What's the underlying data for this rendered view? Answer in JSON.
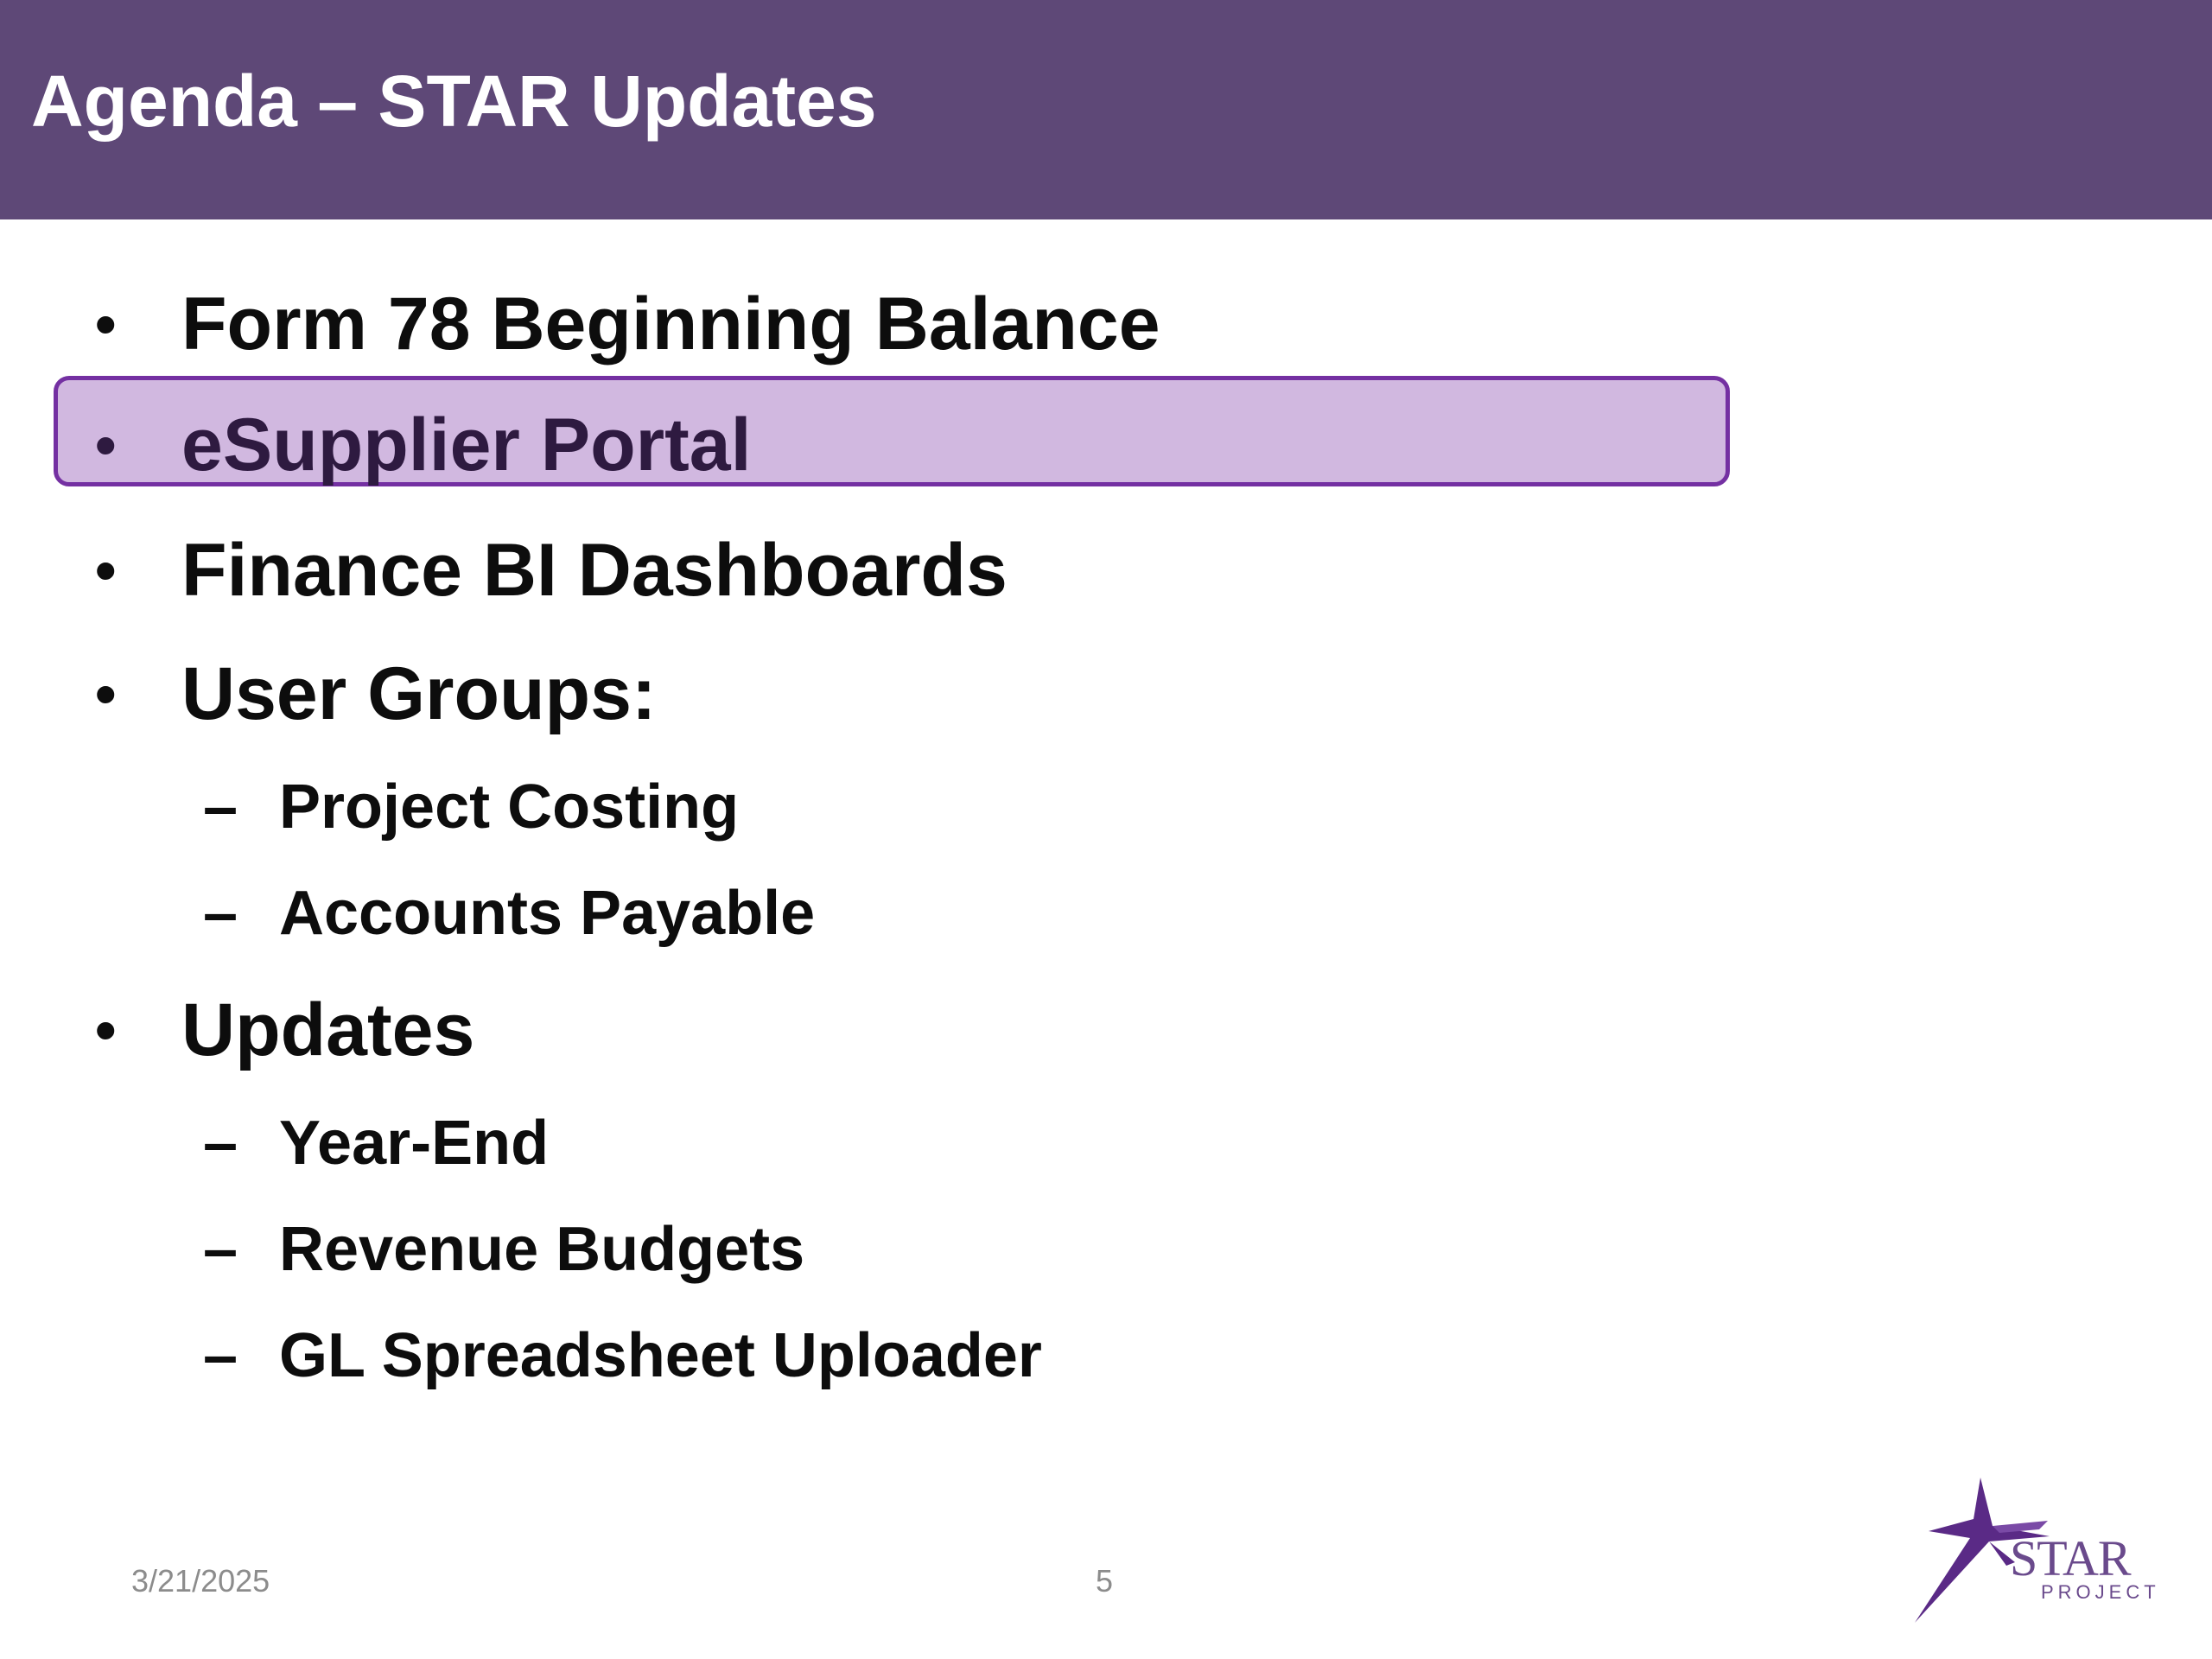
{
  "slide": {
    "title": "Agenda – STAR Updates",
    "items": [
      {
        "level": 1,
        "marker": "•",
        "text": "Form 78 Beginning Balance"
      },
      {
        "level": 1,
        "marker": "•",
        "text": "eSupplier Portal",
        "highlighted": true
      },
      {
        "level": 1,
        "marker": "•",
        "text": "Finance BI Dashboards"
      },
      {
        "level": 1,
        "marker": "•",
        "text": "User Groups:"
      },
      {
        "level": 2,
        "marker": "–",
        "text": "Project Costing"
      },
      {
        "level": 2,
        "marker": "–",
        "text": "Accounts Payable"
      },
      {
        "level": 1,
        "marker": "•",
        "text": "Updates"
      },
      {
        "level": 2,
        "marker": "–",
        "text": "Year-End"
      },
      {
        "level": 2,
        "marker": "–",
        "text": "Revenue Budgets"
      },
      {
        "level": 2,
        "marker": "–",
        "text": "GL Spreadsheet Uploader"
      }
    ],
    "footer": {
      "date": "3/21/2025",
      "page": "5"
    },
    "logo": {
      "name": "STAR",
      "sub": "PROJECT",
      "icon": "star-logo-icon"
    }
  },
  "colors": {
    "title_bar": "#5e4877",
    "highlight_fill": "#d1b8e0",
    "highlight_border": "#7430a2",
    "text": "#0d0d0d",
    "footer_text": "#8c8c8c"
  }
}
